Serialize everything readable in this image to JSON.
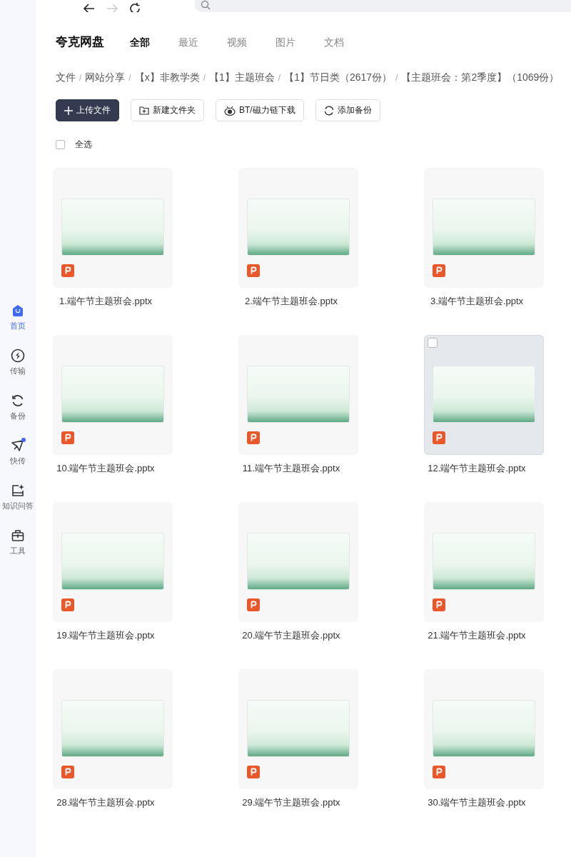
{
  "toolbar": {
    "back": {
      "disabled": false
    },
    "forward": {
      "disabled": true
    }
  },
  "sidebar": {
    "items": [
      {
        "label": "首页",
        "selected": true,
        "dot": false
      },
      {
        "label": "传输",
        "selected": false,
        "dot": false
      },
      {
        "label": "备份",
        "selected": false,
        "dot": false
      },
      {
        "label": "快传",
        "selected": false,
        "dot": true
      },
      {
        "label": "知识问答",
        "selected": false,
        "dot": false
      },
      {
        "label": "工具",
        "selected": false,
        "dot": false
      }
    ]
  },
  "app_title": "夸克网盘",
  "tabs": [
    {
      "label": "全部",
      "selected": true
    },
    {
      "label": "最近",
      "selected": false
    },
    {
      "label": "视频",
      "selected": false
    },
    {
      "label": "图片",
      "selected": false
    },
    {
      "label": "文档",
      "selected": false
    }
  ],
  "breadcrumb": [
    {
      "label": "文件"
    },
    {
      "separator": "/",
      "label": "网站分享"
    },
    {
      "separator": "/",
      "label": "【x】非教学类"
    },
    {
      "separator": "/",
      "label": "【1】主题班会"
    },
    {
      "separator": "/",
      "label": "【1】节日类（2617份）"
    },
    {
      "separator": "/",
      "label": "【主题班会：第2季度】（1069份）"
    }
  ],
  "actions": [
    {
      "label": "上传文件",
      "kind": "primary"
    },
    {
      "label": "新建文件夹",
      "kind": "outline"
    },
    {
      "label": "BT/磁力链下载",
      "kind": "outline"
    },
    {
      "label": "添加备份",
      "kind": "outline"
    }
  ],
  "select_all": {
    "label": "全选",
    "checked": false
  },
  "files": [
    {
      "name": "1.端午节主题班会.pptx",
      "hovered": false
    },
    {
      "name": "2.端午节主题班会.pptx",
      "hovered": false
    },
    {
      "name": "3.端午节主题班会.pptx",
      "hovered": false
    },
    {
      "name": "10.端午节主题班会.pptx",
      "hovered": false
    },
    {
      "name": "11.端午节主题班会.pptx",
      "hovered": false
    },
    {
      "name": "12.端午节主题班会.pptx",
      "hovered": true
    },
    {
      "name": "19.端午节主题班会.pptx",
      "hovered": false
    },
    {
      "name": "20.端午节主题班会.pptx",
      "hovered": false
    },
    {
      "name": "21.端午节主题班会.pptx",
      "hovered": false
    },
    {
      "name": "28.端午节主题班会.pptx",
      "hovered": false
    },
    {
      "name": "29.端午节主题班会.pptx",
      "hovered": false
    },
    {
      "name": "30.端午节主题班会.pptx",
      "hovered": false
    }
  ]
}
